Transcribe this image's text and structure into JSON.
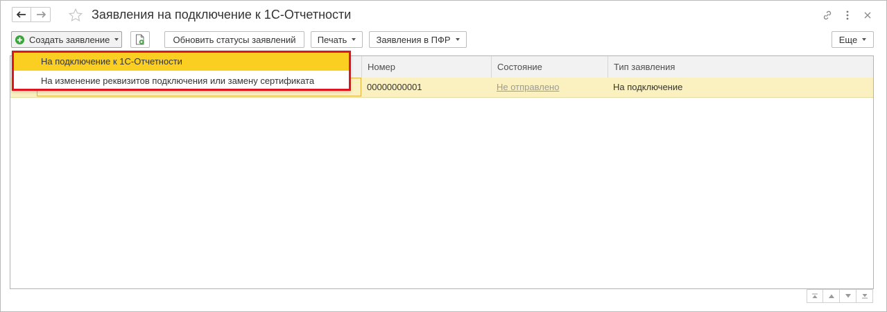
{
  "window": {
    "title": "Заявления на подключение к 1С-Отчетности"
  },
  "toolbar": {
    "create_label": "Создать заявление",
    "refresh_label": "Обновить статусы заявлений",
    "print_label": "Печать",
    "pfr_label": "Заявления в ПФР",
    "more_label": "Еще"
  },
  "menu": {
    "items": [
      {
        "label": "На подключение к 1С-Отчетности"
      },
      {
        "label": "На изменение реквизитов подключения или замену сертификата"
      }
    ]
  },
  "table": {
    "columns": [
      "Номер",
      "Состояние",
      "Тип заявления"
    ],
    "rows": [
      {
        "number": "00000000001",
        "state": "Не отправлено",
        "type": "На подключение"
      }
    ]
  },
  "colors": {
    "menu_highlight": "#fbce22",
    "menu_border": "#e0141e",
    "row_selected": "#fbf1c0",
    "create_icon": "#3aa53a"
  },
  "icons": [
    "arrow-left-icon",
    "arrow-right-icon",
    "star-icon",
    "link-icon",
    "more-vertical-icon",
    "close-icon",
    "plus-circle-icon",
    "document-add-icon",
    "first-page-icon",
    "page-up-icon",
    "page-down-icon",
    "last-page-icon"
  ]
}
